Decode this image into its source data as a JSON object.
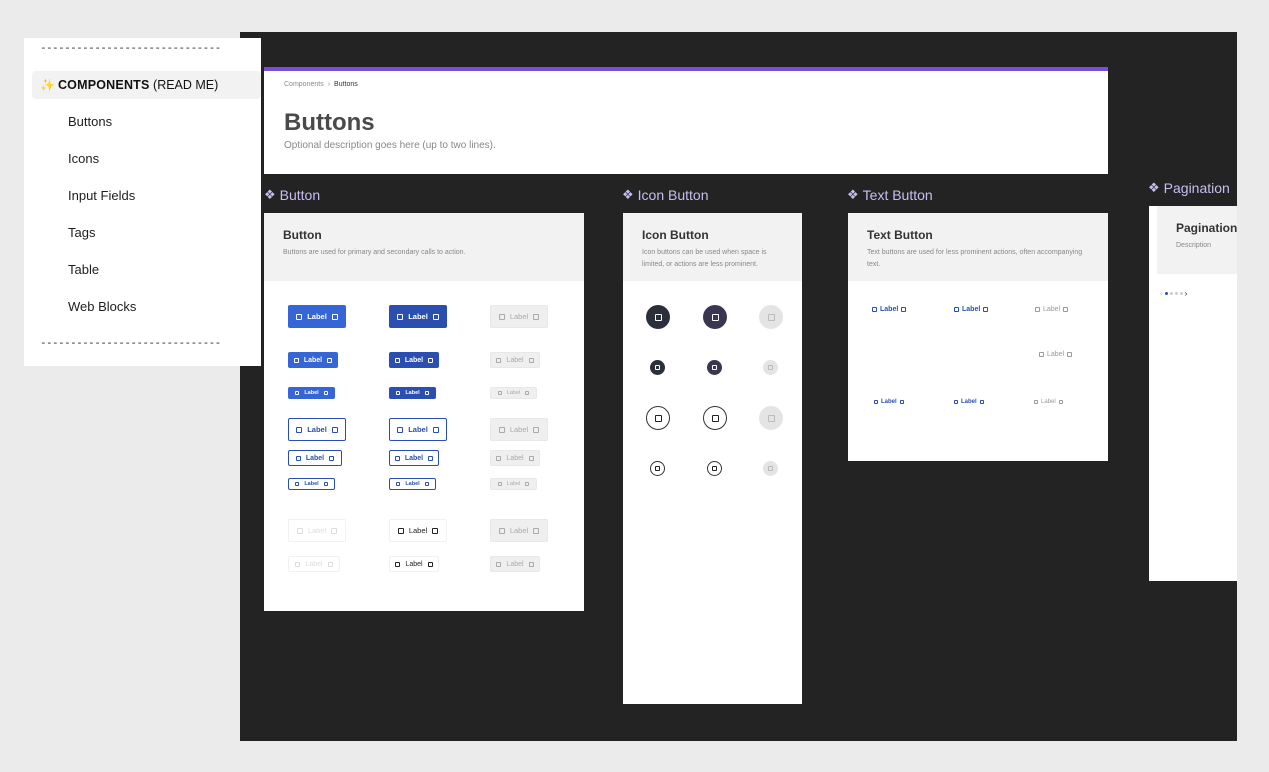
{
  "sidebar": {
    "divider_top": "------------------------------",
    "divider_bottom": "------------------------------",
    "heading_icon": "✨",
    "heading_bold": "COMPONENTS",
    "heading_rest": "(READ ME)",
    "items": [
      {
        "label": "Buttons"
      },
      {
        "label": "Icons"
      },
      {
        "label": "Input Fields"
      },
      {
        "label": "Tags"
      },
      {
        "label": "Table"
      },
      {
        "label": "Web Blocks"
      }
    ]
  },
  "header": {
    "breadcrumb": [
      "Components",
      "Buttons"
    ],
    "breadcrumb_separator": "›",
    "title": "Buttons",
    "description": "Optional description goes here (up to two lines)."
  },
  "sections": {
    "button": {
      "label": "Button",
      "title": "Button",
      "description": "Buttons are used for primary and secondary calls to action.",
      "button_label": "Label"
    },
    "icon_button": {
      "label": "Icon Button",
      "title": "Icon Button",
      "description": "Icon buttons can be used when space is limited, or actions are less prominent."
    },
    "text_button": {
      "label": "Text Button",
      "title": "Text Button",
      "description": "Text buttons are used for less prominent actions, often accompanying text.",
      "button_label": "Label"
    },
    "pagination": {
      "label": "Pagination",
      "title": "Pagination",
      "description": "Description",
      "prev": "‹",
      "next": "›"
    }
  },
  "colors": {
    "canvas": "#232323",
    "accent": "#7c4ddb",
    "primary": "#3665d6",
    "primary_dark": "#2a4fb0",
    "section_label": "#c9bdf0"
  },
  "icons": {
    "component": "❖",
    "sparkle": "sparkle-icon"
  }
}
